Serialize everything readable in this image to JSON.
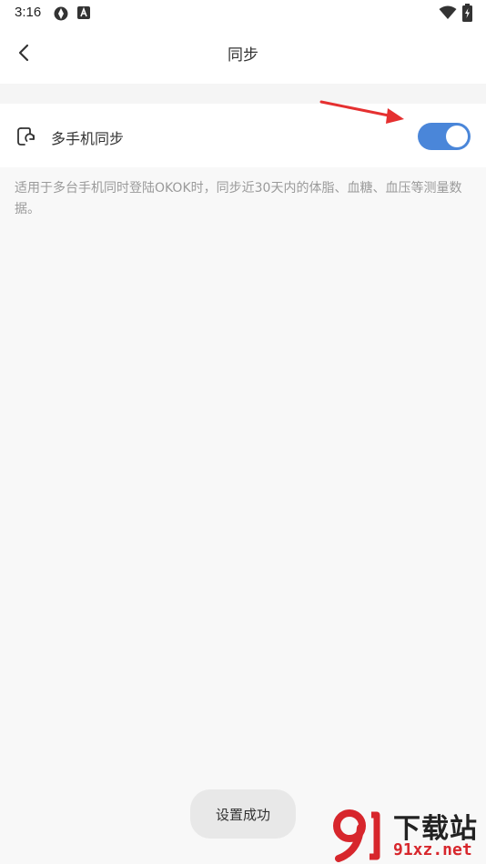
{
  "status_bar": {
    "time": "3:16",
    "icons": [
      "aperture-icon",
      "a-badge-icon",
      "wifi-icon",
      "battery-charging-icon"
    ]
  },
  "header": {
    "title": "同步",
    "back_icon": "chevron-left-icon"
  },
  "setting": {
    "label": "多手机同步",
    "icon": "sync-phone-icon",
    "toggle_on": true,
    "toggle_color": "#4a86d9"
  },
  "description": "适用于多台手机同时登陆OKOK时，同步近30天内的体脂、血糖、血压等测量数据。",
  "toast": {
    "text": "设置成功"
  },
  "watermark": {
    "top_text": "下载站",
    "bottom_text": "91xz.net",
    "logo_color": "#d7262c"
  }
}
